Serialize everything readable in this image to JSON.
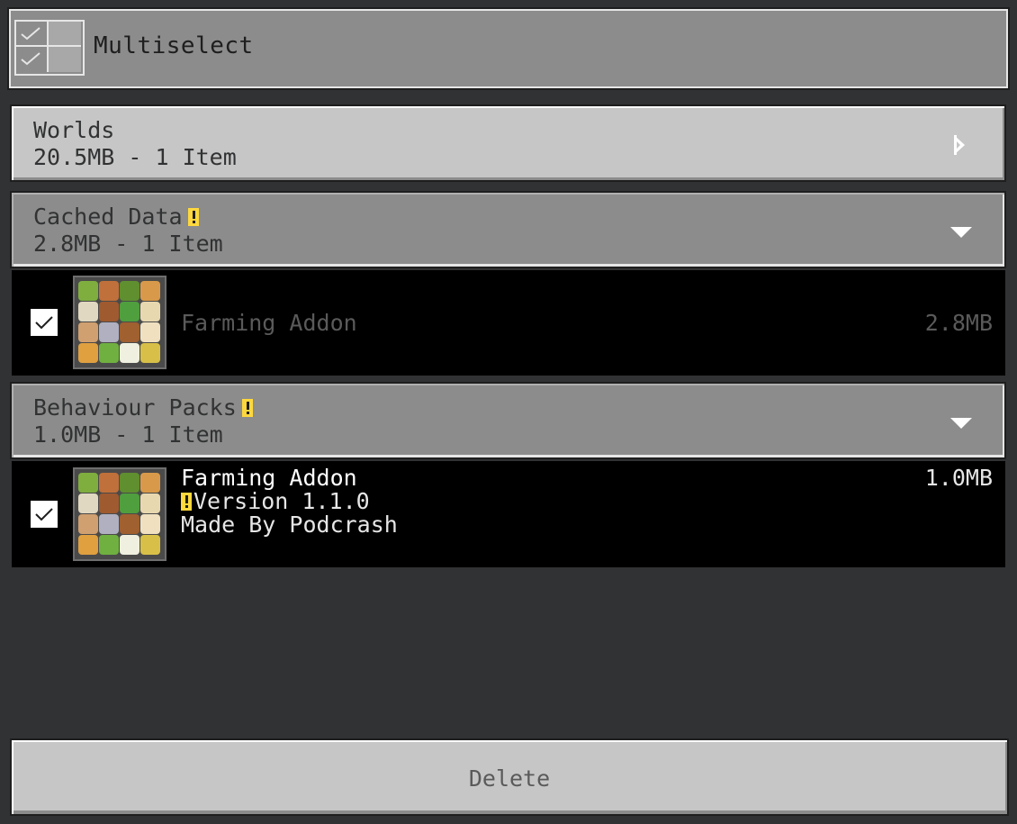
{
  "multiselect": {
    "label": "Multiselect"
  },
  "categories": [
    {
      "title": "Worlds",
      "subtitle": "20.5MB - 1 Item",
      "warning": false,
      "expanded": false
    },
    {
      "title": "Cached Data",
      "subtitle": "2.8MB - 1 Item",
      "warning": true,
      "expanded": true,
      "items": [
        {
          "name": "Farming Addon",
          "size": "2.8MB",
          "checked": true,
          "dimmed": true
        }
      ]
    },
    {
      "title": "Behaviour Packs",
      "subtitle": "1.0MB - 1 Item",
      "warning": true,
      "expanded": true,
      "items": [
        {
          "name": "Farming Addon",
          "version": "Version 1.1.0",
          "author": "Made By Podcrash",
          "size": "1.0MB",
          "checked": true,
          "dimmed": false
        }
      ]
    }
  ],
  "footer": {
    "delete_label": "Delete"
  },
  "colors": {
    "background": "#313233",
    "panel_light": "#c6c6c6",
    "panel_dark": "#8c8c8c",
    "warning": "#ffd83d",
    "row_bg": "#000000"
  },
  "icons": [
    "multiselect-icon",
    "checkmark-icon",
    "chevron-right-icon",
    "chevron-down-icon",
    "warning-icon",
    "addon-pack-icon"
  ]
}
